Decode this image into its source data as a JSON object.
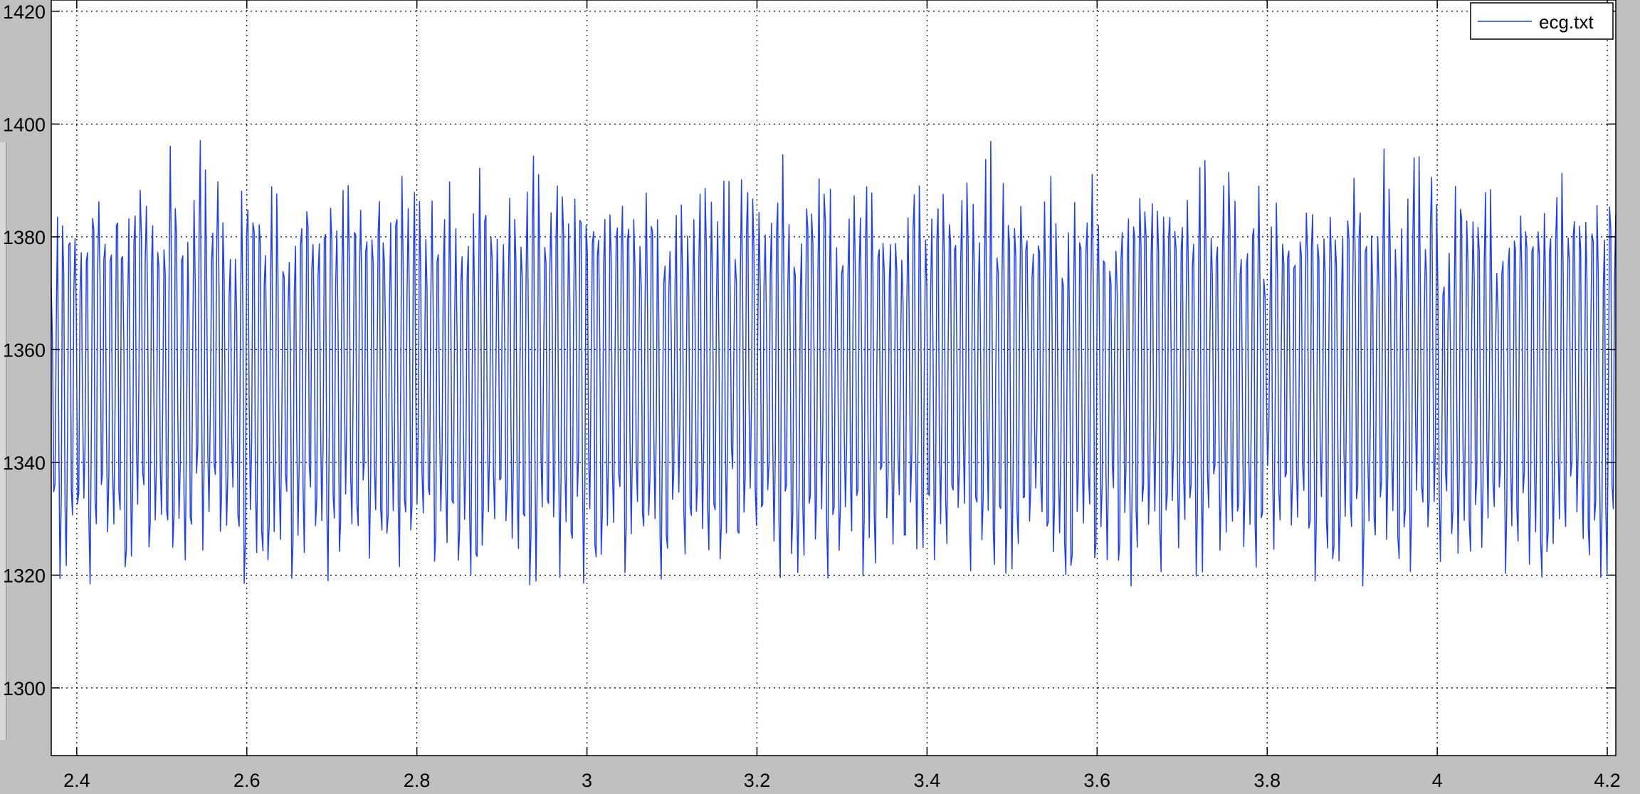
{
  "colors": {
    "window_bg": "#c0c0c0",
    "plot_bg": "#ffffff",
    "series": "#1f3fff",
    "grid": "#000000"
  },
  "chart_data": {
    "type": "line",
    "title": "",
    "xlabel": "",
    "ylabel": "",
    "xlim": [
      2.37,
      4.21
    ],
    "ylim": [
      1288,
      1422
    ],
    "xticks": [
      2.4,
      2.6,
      2.8,
      3,
      3.2,
      3.4,
      3.6,
      3.8,
      4,
      4.2
    ],
    "xtick_labels": [
      "2.4",
      "2.6",
      "2.8",
      "3",
      "3.2",
      "3.4",
      "3.6",
      "3.8",
      "4",
      "4.2"
    ],
    "yticks": [
      1300,
      1320,
      1340,
      1360,
      1380,
      1400,
      1420
    ],
    "ytick_labels": [
      "1300",
      "1320",
      "1340",
      "1360",
      "1380",
      "1400",
      "1420"
    ],
    "grid": true,
    "grid_style": "dotted",
    "legend_position": "top-right",
    "series": [
      {
        "name": "ecg.txt",
        "color": "#1f3fff",
        "description": "dense oscillation between about 1317 and 1398",
        "x_start": 2.37,
        "x_end": 4.21,
        "samples": 1250,
        "cycles": 263,
        "peaks": [
          1371,
          1386,
          1378,
          1387,
          1379,
          1379,
          1383,
          1391,
          1385,
          1380,
          1382,
          1393,
          1375,
          1384,
          1389,
          1390,
          1384,
          1382,
          1379,
          1384,
          1395,
          1380,
          1381,
          1374,
          1386,
          1397,
          1378,
          1391,
          1390,
          1372,
          1378,
          1375,
          1389,
          1385,
          1384,
          1390,
          1378,
          1390,
          1375,
          1380,
          1377,
          1380,
          1385,
          1390,
          1380,
          1381,
          1385,
          1388,
          1382,
          1391,
          1380,
          1390,
          1385,
          1382,
          1380,
          1398,
          1375,
          1385,
          1390,
          1383,
          1384,
          1390,
          1379,
          1380,
          1385,
          1378,
          1390,
          1375,
          1380,
          1377,
          1385,
          1380,
          1391,
          1384,
          1381,
          1377,
          1378,
          1387,
          1380,
          1385,
          1388,
          1395,
          1380,
          1387,
          1385,
          1390,
          1384,
          1379,
          1388,
          1384,
          1380,
          1395,
          1381,
          1385,
          1380,
          1392,
          1387,
          1384,
          1378,
          1380,
          1389,
          1384
        ],
        "troughs": [
          1332,
          1318,
          1322,
          1330,
          1330,
          1332,
          1318,
          1328,
          1334,
          1326,
          1328,
          1330,
          1320,
          1322,
          1331,
          1334,
          1324,
          1329,
          1329,
          1327,
          1324,
          1330,
          1321,
          1326,
          1338,
          1325,
          1330,
          1334,
          1327,
          1330,
          1335,
          1325,
          1317,
          1333,
          1324,
          1320,
          1321,
          1329,
          1327,
          1332,
          1317,
          1328,
          1325,
          1333,
          1326,
          1330,
          1320,
          1328,
          1321,
          1334,
          1330,
          1327,
          1334,
          1322,
          1332,
          1326,
          1325,
          1330,
          1321,
          1330,
          1326,
          1331,
          1330,
          1333,
          1321,
          1330,
          1324,
          1331,
          1322,
          1329,
          1318,
          1320,
          1325,
          1331,
          1328,
          1334,
          1330,
          1327,
          1323,
          1326,
          1318,
          1320,
          1331,
          1328,
          1330,
          1321,
          1329,
          1322,
          1333,
          1320
        ]
      }
    ]
  }
}
